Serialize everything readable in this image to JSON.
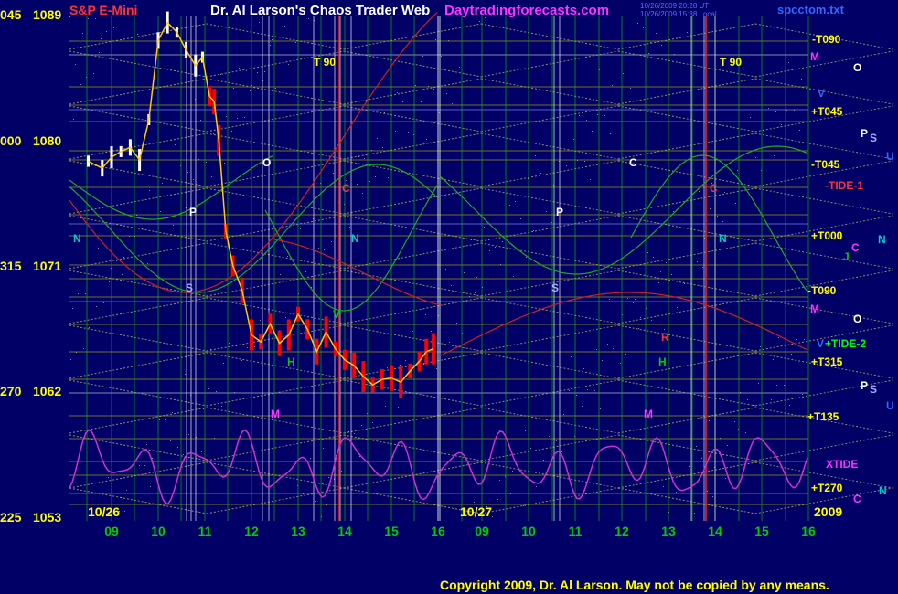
{
  "header": {
    "instrument": "S&P E-Mini",
    "title": "Dr. Al Larson's Chaos Trader Web",
    "site": "Daytradingforecasts.com",
    "stamp1": "10/26/2009 20:28 UT",
    "stamp2": "10/26/2009 15:38 Local",
    "file": "spcctom.txt"
  },
  "footer": {
    "copyright": "Copyright 2009, Dr. Al Larson. May not be copied by any means."
  },
  "colors": {
    "background": "#000066",
    "price": "#FF0000",
    "bar_white": "#FFFFFF",
    "grid_vertical": "#00CC00",
    "grid_horizontal": "#CCCC00",
    "xtide": "#CC33CC",
    "wave_green": "#22AA22",
    "wave_red": "#CC2222",
    "title_yellow": "#FFFF00",
    "date_green": "#00CC00",
    "label_cyan": "#00CCCC"
  },
  "chart_data": {
    "type": "line",
    "ylim": [
      1053,
      1089
    ],
    "y_ticks": [
      {
        "value": 1089,
        "angle_label": "045"
      },
      {
        "value": 1080,
        "angle_label": "000"
      },
      {
        "value": 1071,
        "angle_label": "315"
      },
      {
        "value": 1062,
        "angle_label": "270"
      },
      {
        "value": 1053,
        "angle_label": "225"
      }
    ],
    "x_hour_ticks": [
      "09",
      "10",
      "11",
      "12",
      "13",
      "14",
      "15",
      "16",
      "09",
      "10",
      "11",
      "12",
      "13",
      "14",
      "15",
      "16"
    ],
    "day_labels": [
      "10/26",
      "10/27"
    ],
    "year_label": "2009",
    "price_series": {
      "name": "S&P E-Mini",
      "hours": [
        8.5,
        8.8,
        9.0,
        9.2,
        9.4,
        9.6,
        9.8,
        10.0,
        10.2,
        10.4,
        10.6,
        10.8,
        10.95,
        11.1,
        11.2,
        11.3,
        11.45,
        11.6,
        11.8,
        12.0,
        12.2,
        12.4,
        12.6,
        12.8,
        13.0,
        13.2,
        13.4,
        13.6,
        13.8,
        14.0,
        14.2,
        14.4,
        14.6,
        14.8,
        15.0,
        15.2,
        15.4,
        15.6,
        15.75,
        15.9
      ],
      "values": [
        1078.5,
        1078.0,
        1078.8,
        1079.2,
        1079.5,
        1078.6,
        1081.5,
        1087.2,
        1088.5,
        1087.8,
        1086.5,
        1085.4,
        1086.0,
        1083.2,
        1082.8,
        1080.0,
        1073.5,
        1071.0,
        1069.2,
        1066.0,
        1065.5,
        1066.8,
        1065.4,
        1066.0,
        1067.5,
        1066.4,
        1064.8,
        1066.2,
        1065.0,
        1064.2,
        1063.8,
        1063.0,
        1062.4,
        1062.8,
        1062.9,
        1062.6,
        1063.4,
        1064.1,
        1064.8,
        1065.0
      ]
    },
    "right_labels": [
      "-T090",
      "M",
      "V",
      "+T045",
      "-T045",
      "-TIDE-1",
      "+T000",
      "-T090",
      "M",
      "V",
      "+TIDE-2",
      "+T315",
      "+T135",
      "XTIDE",
      "+T270",
      "2009"
    ],
    "right_marks": [
      "O",
      "P",
      "S",
      "U",
      "C",
      "J",
      "N",
      "O",
      "P",
      "S",
      "U",
      "C",
      "N"
    ],
    "chart_annotations": [
      "T 90",
      "T 90",
      "N",
      "N",
      "P",
      "P",
      "S",
      "S",
      "O",
      "O",
      "C",
      "C",
      "H",
      "H",
      "M",
      "M",
      "R"
    ]
  }
}
